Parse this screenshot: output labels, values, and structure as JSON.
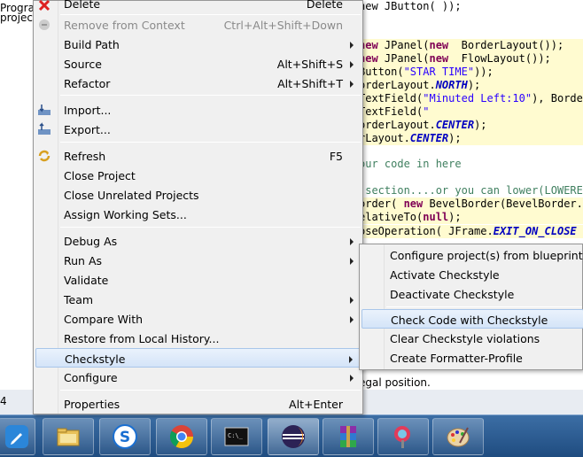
{
  "left_tree": {
    "line1": "Progra",
    "line2": "project"
  },
  "code_lines": [
    {
      "segments": [
        {
          "t": "new JButton( ));",
          "c": "plain"
        }
      ],
      "hl": false
    },
    {
      "segments": [
        {
          "t": "",
          "c": "plain"
        }
      ],
      "hl": false
    },
    {
      "segments": [
        {
          "t": "new",
          "c": "kw"
        },
        {
          "t": " JPanel(",
          "c": "plain"
        },
        {
          "t": "new",
          "c": "kw"
        },
        {
          "t": "  BorderLayout());",
          "c": "plain"
        }
      ],
      "hl": true
    },
    {
      "segments": [
        {
          "t": "new",
          "c": "kw"
        },
        {
          "t": " JPanel(",
          "c": "plain"
        },
        {
          "t": "new",
          "c": "kw"
        },
        {
          "t": "  FlowLayout());",
          "c": "plain"
        }
      ],
      "hl": true
    },
    {
      "segments": [
        {
          "t": "Button(",
          "c": "plain"
        },
        {
          "t": "\"STAR TIME\"",
          "c": "str"
        },
        {
          "t": "));",
          "c": "plain"
        }
      ],
      "hl": true
    },
    {
      "segments": [
        {
          "t": "orderLayout.",
          "c": "plain"
        },
        {
          "t": "NORTH",
          "c": "const"
        },
        {
          "t": ");",
          "c": "plain"
        }
      ],
      "hl": true
    },
    {
      "segments": [
        {
          "t": "TextField(",
          "c": "plain"
        },
        {
          "t": "\"Minuted Left:10\"",
          "c": "str"
        },
        {
          "t": "), Border",
          "c": "plain"
        }
      ],
      "hl": true
    },
    {
      "segments": [
        {
          "t": "TextField(",
          "c": "plain"
        },
        {
          "t": "\"",
          "c": "str"
        }
      ],
      "hl": true
    },
    {
      "segments": [
        {
          "t": "orderLayout.",
          "c": "plain"
        },
        {
          "t": "CENTER",
          "c": "const"
        },
        {
          "t": ");",
          "c": "plain"
        }
      ],
      "hl": true
    },
    {
      "segments": [
        {
          "t": "rLayout.",
          "c": "plain"
        },
        {
          "t": "CENTER",
          "c": "const"
        },
        {
          "t": ");",
          "c": "plain"
        }
      ],
      "hl": true
    },
    {
      "segments": [
        {
          "t": "",
          "c": "plain"
        }
      ],
      "hl": false
    },
    {
      "segments": [
        {
          "t": "our code in here",
          "c": "cmt"
        }
      ],
      "hl": false
    },
    {
      "segments": [
        {
          "t": "",
          "c": "plain"
        }
      ],
      "hl": false
    },
    {
      "segments": [
        {
          "t": " section....or you can lower(LOWERED",
          "c": "cmt"
        }
      ],
      "hl": false
    },
    {
      "segments": [
        {
          "t": "order( ",
          "c": "plain"
        },
        {
          "t": "new",
          "c": "kw"
        },
        {
          "t": " BevelBorder(BevelBorder.R",
          "c": "plain"
        }
      ],
      "hl": true
    },
    {
      "segments": [
        {
          "t": "elativeTo(",
          "c": "plain"
        },
        {
          "t": "null",
          "c": "kw"
        },
        {
          "t": ");",
          "c": "plain"
        }
      ],
      "hl": true
    },
    {
      "segments": [
        {
          "t": "oseOperation( JFrame.",
          "c": "plain"
        },
        {
          "t": "EXIT_ON_CLOSE",
          "c": "const"
        },
        {
          "t": " )",
          "c": "plain"
        }
      ],
      "hl": true
    }
  ],
  "bottom_line": "egal position.",
  "status_num": "4",
  "context_menu": {
    "top_partial": {
      "label": "Delete",
      "shortcut": "Delete"
    },
    "items": [
      {
        "label": "Remove from Context",
        "shortcut": "Ctrl+Alt+Shift+Down",
        "disabled": true
      },
      {
        "label": "Build Path",
        "submenu": true
      },
      {
        "label": "Source",
        "shortcut": "Alt+Shift+S",
        "submenu": true
      },
      {
        "label": "Refactor",
        "shortcut": "Alt+Shift+T",
        "submenu": true
      },
      {
        "label": "Import..."
      },
      {
        "label": "Export..."
      },
      {
        "label": "Refresh",
        "shortcut": "F5"
      },
      {
        "label": "Close Project"
      },
      {
        "label": "Close Unrelated Projects"
      },
      {
        "label": "Assign Working Sets..."
      },
      {
        "label": "Debug As",
        "submenu": true
      },
      {
        "label": "Run As",
        "submenu": true
      },
      {
        "label": "Validate"
      },
      {
        "label": "Team",
        "submenu": true
      },
      {
        "label": "Compare With",
        "submenu": true
      },
      {
        "label": "Restore from Local History..."
      },
      {
        "label": "Checkstyle",
        "submenu": true,
        "selected": true
      },
      {
        "label": "Configure",
        "submenu": true
      },
      {
        "label": "Properties",
        "shortcut": "Alt+Enter"
      }
    ]
  },
  "submenu": {
    "items": [
      {
        "label": "Configure project(s) from blueprint..."
      },
      {
        "label": "Activate Checkstyle"
      },
      {
        "label": "Deactivate Checkstyle"
      },
      {
        "label": "Check Code with Checkstyle",
        "selected": true
      },
      {
        "label": "Clear Checkstyle violations"
      },
      {
        "label": "Create Formatter-Profile"
      }
    ]
  },
  "taskbar": {
    "items": [
      "pen-app-icon",
      "file-explorer-icon",
      "sogou-browser-icon",
      "chrome-icon",
      "command-prompt-icon",
      "eclipse-icon",
      "winrar-icon",
      "paint-tool-icon",
      "paint-palette-icon"
    ]
  },
  "colors": {
    "menu_bg": "#f0f0f0",
    "selection_border": "#a9c6ea",
    "taskbar": "#2a5a90",
    "code_highlight": "#fffbd0"
  }
}
